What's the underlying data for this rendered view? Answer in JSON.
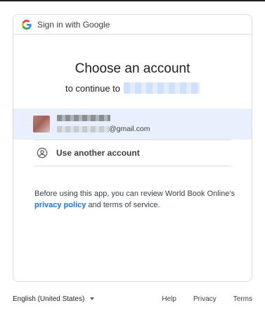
{
  "header": {
    "text": "Sign in with Google",
    "logo_icon": "google-g-icon"
  },
  "main": {
    "title": "Choose an account",
    "subtitle_prefix": "to continue to"
  },
  "account": {
    "email_suffix": "@gmail.com",
    "avatar_icon": "avatar"
  },
  "another_account": {
    "label": "Use another account",
    "icon": "person-circle-icon"
  },
  "notice": {
    "text_before": "Before using this app, you can review World Book Online’s",
    "privacy_link": "privacy policy",
    "text_after": "and terms of service."
  },
  "footer": {
    "language": "English (United States)",
    "help": "Help",
    "privacy": "Privacy",
    "terms": "Terms"
  },
  "colors": {
    "accent": "#1a73e8",
    "selected_row": "#e8f0fe",
    "border": "#dadce0"
  }
}
